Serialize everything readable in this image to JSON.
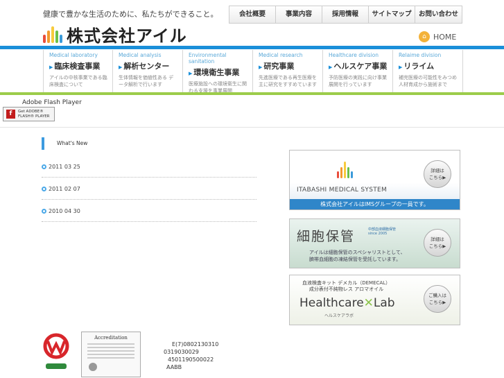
{
  "header": {
    "tagline": "健康で豊かな生活のために、私たちができること。",
    "company_name": "株式会社アイル",
    "home_label": "HOME"
  },
  "top_nav": [
    {
      "label": "会社概要"
    },
    {
      "label": "事業内容"
    },
    {
      "label": "採用情報"
    },
    {
      "label": "サイトマップ"
    },
    {
      "label": "お問い合わせ"
    }
  ],
  "divisions": [
    {
      "en": "Medical laboratory",
      "jp": "臨床検査事業",
      "desc": "アイルの中核事業である臨床検査について"
    },
    {
      "en": "Medical analysis",
      "jp": "解析センター",
      "desc": "生体情報を価値性ある データ解析で行います"
    },
    {
      "en": "Environmental sanitation",
      "jp": "環境衛生事業",
      "desc": "医療施設への環境衛生に関わる支援を事業展開"
    },
    {
      "en": "Medical research",
      "jp": "研究事業",
      "desc": "先進医療である再生医療を主に研究をすすめています"
    },
    {
      "en": "Healthcare division",
      "jp": "ヘルスケア事業",
      "desc": "予防医療の実践に向け事業展開を行っています"
    },
    {
      "en": "Relaime division",
      "jp": "リライム",
      "desc": "補完医療の可能性をみつめ人材育成から施術まで"
    }
  ],
  "flash": {
    "label": "Adobe Flash Player",
    "button_line1": "Get ADOBE®",
    "button_line2": "FLASH® PLAYER"
  },
  "news": {
    "heading": "What's New",
    "items": [
      {
        "date": "2011 03 25"
      },
      {
        "date": "2011 02 07"
      },
      {
        "date": "2010 04 30"
      }
    ]
  },
  "banners": {
    "ims": {
      "name": "ITABASHI MEDICAL SYSTEM",
      "bar_text": "株式会社アイルはIMSグループの一員です。",
      "button_line1": "詳細は",
      "button_line2": "こちら▶"
    },
    "cell": {
      "title": "細胞保管",
      "badge_line1": "中部血液細胞保管",
      "badge_line2": "since 2005",
      "text_line1": "アイルは細胞保管のスペシャリストとして、",
      "text_line2": "臍帯血細胞の凍結保管を受託しています。",
      "button_line1": "詳細は",
      "button_line2": "こちら▶"
    },
    "healthcare": {
      "top_line1": "血液検査キット デメカル（DEMECAL）",
      "top_line2": "成分表付不純物レス アロマオイル",
      "brand_left": "Healthcare",
      "brand_mid": "✕",
      "brand_right": "Lab",
      "sub": "ヘルスケアラボ",
      "button_line1": "ご購入は",
      "button_line2": "こちら▶"
    }
  },
  "footer": {
    "cert_title": "Accreditation",
    "codes": [
      "E(7)0802130310",
      "0319030029",
      "4501190500022",
      "AABB"
    ]
  },
  "colors": {
    "brand_blue": "#1a8fd9",
    "accent_green": "#9ccc4a",
    "logo_bars": [
      "#e94e3c",
      "#f29a2e",
      "#f7cb3d",
      "#6cc04a",
      "#3a9ad9"
    ]
  }
}
